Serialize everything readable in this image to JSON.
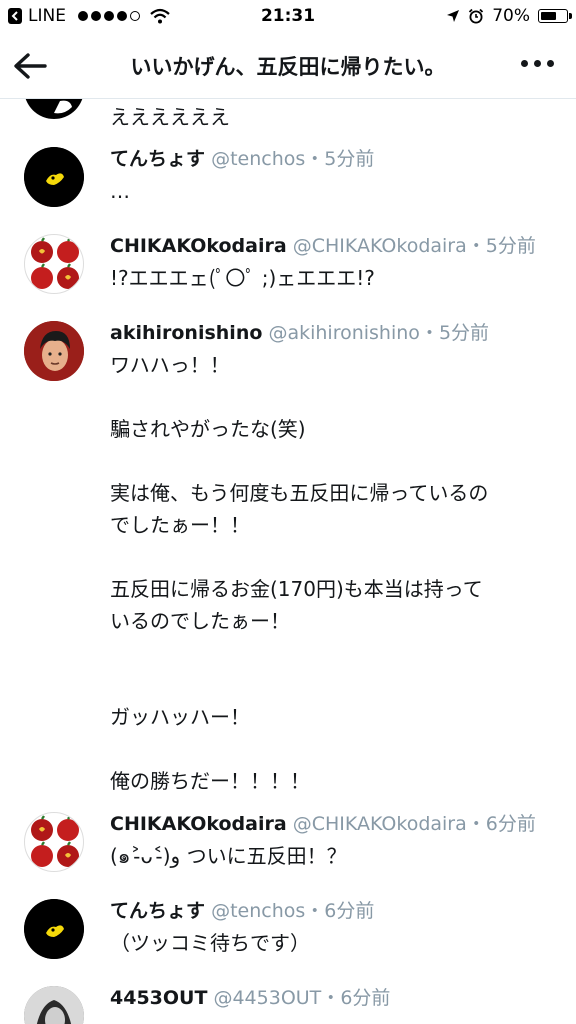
{
  "status_bar": {
    "app": "LINE",
    "time": "21:31",
    "battery": "70%",
    "battery_level": 0.7,
    "signal_filled": 4,
    "signal_total": 5
  },
  "header": {
    "title": "いいかげん、五反田に帰りたい。"
  },
  "top_partial": {
    "text": "ええええええ"
  },
  "replies": [
    {
      "name": "てんちょす",
      "handle": "@tenchos",
      "time": "5分前",
      "text": "…"
    },
    {
      "name": "CHIKAKOkodaira",
      "handle": "@CHIKAKOkodaira",
      "time": "5分前",
      "text": "!?エエエェ(ﾟ〇ﾟ ;)ェエエエ!?"
    },
    {
      "name": "akihironishino",
      "handle": "@akihironishino",
      "time": "5分前",
      "text": "ワハハっ！！\n\n騙されやがったな(笑)\n\n実は俺、もう何度も五反田に帰っているの\nでしたぁー！！\n\n五反田に帰るお金(170円)も本当は持って\nいるのでしたぁー！\n\n\nガッハッハー！\n\n俺の勝ちだー！！！！"
    },
    {
      "name": "CHIKAKOkodaira",
      "handle": "@CHIKAKOkodaira",
      "time": "6分前",
      "text": "(๑˃̵ᴗ˂̵)و ついに五反田！？"
    },
    {
      "name": "てんちょす",
      "handle": "@tenchos",
      "time": "6分前",
      "text": "（ツッコミ待ちです）"
    },
    {
      "name": "4453OUT",
      "handle": "@4453OUT",
      "time": "6分前",
      "text": ""
    }
  ],
  "separator": "・",
  "icons": {
    "back": "arrow-left-icon",
    "more": "more-dots-icon",
    "location": "location-arrow-icon",
    "alarm": "alarm-icon",
    "wifi": "wifi-icon",
    "battery": "battery-icon"
  }
}
